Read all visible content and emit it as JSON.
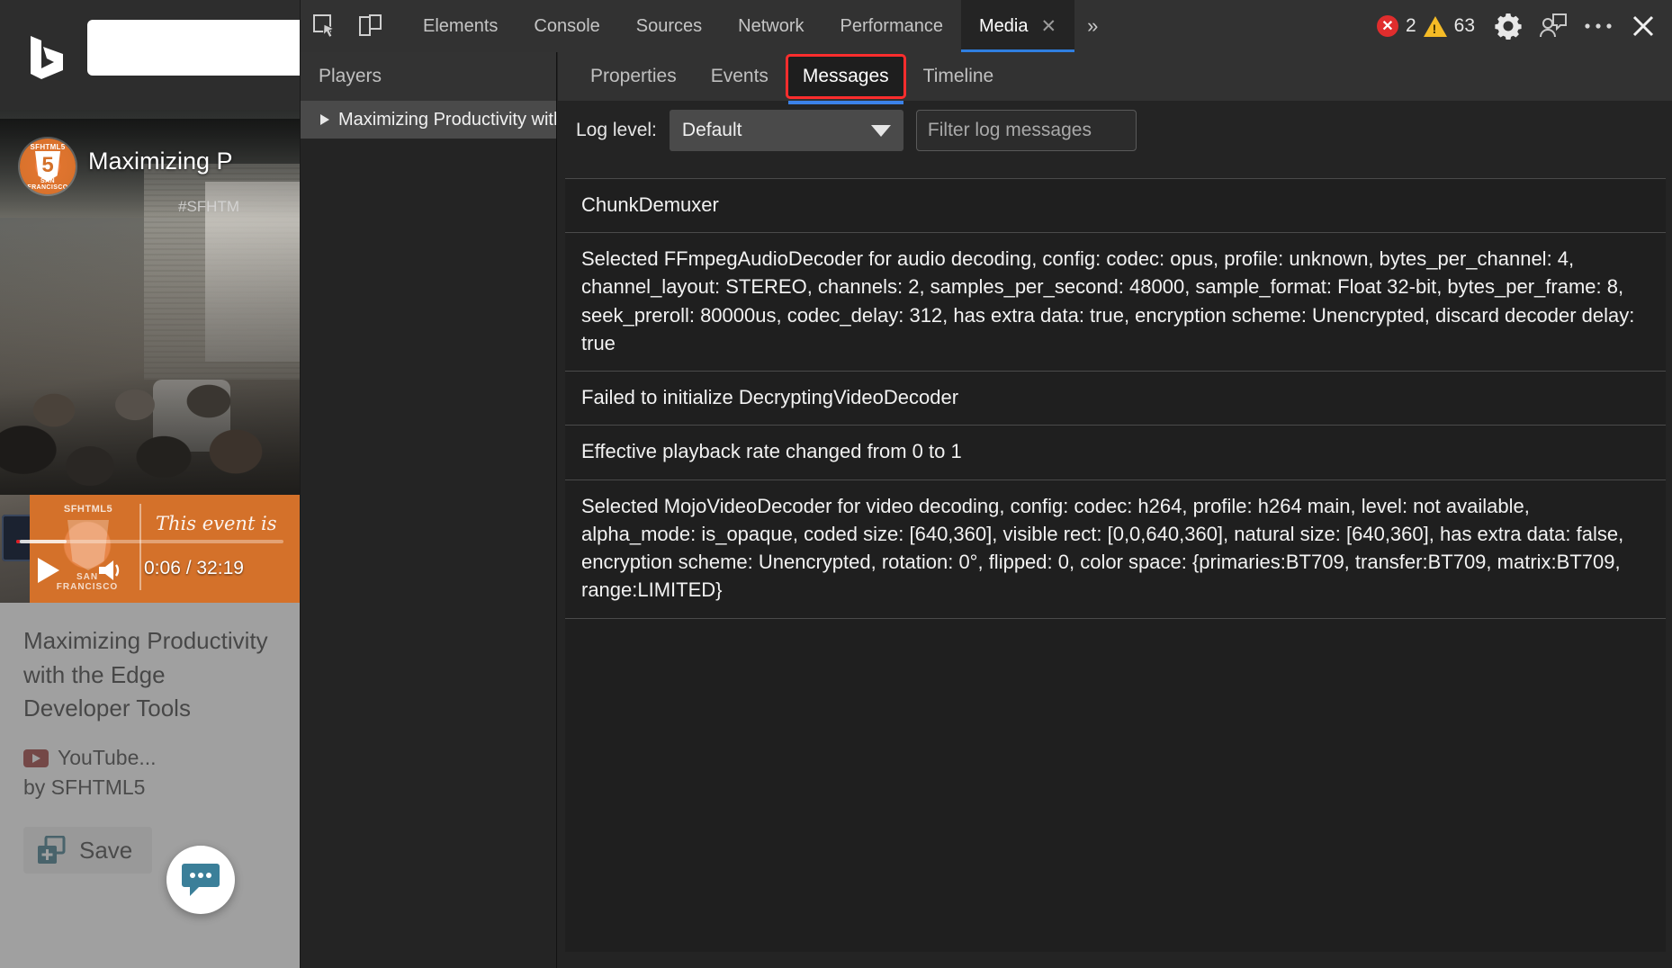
{
  "bing": {
    "logo_name": "bing-logo",
    "search_placeholder": ""
  },
  "video": {
    "overlay_title": "Maximizing P",
    "hashtag": "#SFHTM",
    "avatar_tag": "SFHTML5",
    "avatar_five": "5",
    "avatar_sf": "SAN FRANCISCO",
    "banner_text": "This event is",
    "banner_tag": "SFHTML5",
    "banner_sf": "SAN FRANCISCO",
    "time_display": "0:06 / 32:19",
    "play_label": "play-button",
    "volume_label": "volume-button",
    "title": "Maximizing Productivity with the Edge Developer Tools",
    "source": "YouTube...",
    "byline": "by SFHTML5",
    "save_label": "Save"
  },
  "devtools": {
    "toolbar": {
      "inspect_icon": "inspect-element-icon",
      "device_icon": "device-toolbar-icon",
      "tabs": [
        {
          "label": "Elements",
          "active": false,
          "closable": false
        },
        {
          "label": "Console",
          "active": false,
          "closable": false
        },
        {
          "label": "Sources",
          "active": false,
          "closable": false
        },
        {
          "label": "Network",
          "active": false,
          "closable": false
        },
        {
          "label": "Performance",
          "active": false,
          "closable": false
        },
        {
          "label": "Media",
          "active": true,
          "closable": true
        }
      ],
      "more_tabs": "»",
      "error_count": "2",
      "warning_count": "63",
      "settings_icon": "gear-icon",
      "feedback_icon": "feedback-person-icon",
      "more_icon": "more-options-icon",
      "close_icon": "close-icon"
    },
    "players": {
      "header": "Players",
      "items": [
        {
          "label": "Maximizing Productivity with the Edge Developer Tools",
          "selected": true
        }
      ]
    },
    "media": {
      "subtabs": [
        {
          "label": "Properties",
          "active": false,
          "highlighted": false
        },
        {
          "label": "Events",
          "active": false,
          "highlighted": false
        },
        {
          "label": "Messages",
          "active": true,
          "highlighted": true
        },
        {
          "label": "Timeline",
          "active": false,
          "highlighted": false
        }
      ],
      "log_level_label": "Log level:",
      "log_level_value": "Default",
      "log_level_options": [
        "Default"
      ],
      "filter_placeholder": "Filter log messages",
      "filter_value": "",
      "messages": [
        "ChunkDemuxer",
        "Selected FFmpegAudioDecoder for audio decoding, config: codec: opus, profile: unknown, bytes_per_channel: 4, channel_layout: STEREO, channels: 2, samples_per_second: 48000, sample_format: Float 32-bit, bytes_per_frame: 8, seek_preroll: 80000us, codec_delay: 312, has extra data: true, encryption scheme: Unencrypted, discard decoder delay: true",
        "Failed to initialize DecryptingVideoDecoder",
        "Effective playback rate changed from 0 to 1",
        "Selected MojoVideoDecoder for video decoding, config: codec: h264, profile: h264 main, level: not available, alpha_mode: is_opaque, coded size: [640,360], visible rect: [0,0,640,360], natural size: [640,360], has extra data: false, encryption scheme: Unencrypted, rotation: 0°, flipped: 0, color space: {primaries:BT709, transfer:BT709, matrix:BT709, range:LIMITED}"
      ]
    }
  },
  "colors": {
    "accent_blue": "#3b82e8",
    "highlight_red": "#ff2d2d",
    "error_red": "#e02d2d",
    "warning_yellow": "#f5bb26",
    "panel_bg": "#242424",
    "toolbar_bg": "#323232",
    "list_bg": "#1f1f1f"
  }
}
